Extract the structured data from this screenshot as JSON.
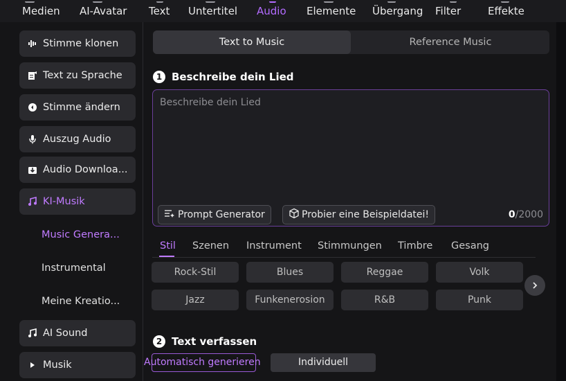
{
  "menu": {
    "tabs": [
      {
        "label": "Medien"
      },
      {
        "label": "AI-Avatar"
      },
      {
        "label": "Text"
      },
      {
        "label": "Untertitel"
      },
      {
        "label": "Audio"
      },
      {
        "label": "Elemente"
      },
      {
        "label": "Übergang"
      },
      {
        "label": "Filter"
      },
      {
        "label": "Effekte"
      }
    ],
    "active": "Audio"
  },
  "sidebar": {
    "items": [
      {
        "label": "Stimme klonen",
        "icon": "waveform-icon"
      },
      {
        "label": "Text zu Sprache",
        "icon": "document-edit-icon"
      },
      {
        "label": "Stimme ändern",
        "icon": "voice-change-icon"
      },
      {
        "label": "Auszug Audio",
        "icon": "microphone-icon"
      },
      {
        "label": "Audio Downloa...",
        "icon": "download-box-icon"
      },
      {
        "label": "KI-Musik",
        "icon": "ai-music-icon"
      }
    ],
    "sub_items": [
      {
        "label": "Music Genera..."
      },
      {
        "label": "Instrumental"
      },
      {
        "label": "Meine Kreatio..."
      }
    ],
    "bottom_items": [
      {
        "label": "AI Sound",
        "icon": "sound-icon"
      },
      {
        "label": "Musik",
        "icon": "caret-right-icon"
      }
    ]
  },
  "mode_tabs": {
    "text_to_music": "Text to Music",
    "reference_music": "Reference Music"
  },
  "section1": {
    "number": "1",
    "title": "Beschreibe dein Lied"
  },
  "description": {
    "placeholder": "Beschreibe dein Lied",
    "value": ""
  },
  "buttons": {
    "prompt_generator": "Prompt Generator",
    "example_file": "Probier eine Beispieldatei!"
  },
  "counter": {
    "current": "0",
    "max": "/2000"
  },
  "categories": [
    {
      "label": "Stil"
    },
    {
      "label": "Szenen"
    },
    {
      "label": "Instrument"
    },
    {
      "label": "Stimmungen"
    },
    {
      "label": "Timbre"
    },
    {
      "label": "Gesang"
    }
  ],
  "styles": [
    {
      "label": "Rock-Stil"
    },
    {
      "label": "Blues"
    },
    {
      "label": "Reggae"
    },
    {
      "label": "Volk"
    },
    {
      "label": "Jazz"
    },
    {
      "label": "Funkenerosion"
    },
    {
      "label": "R&B"
    },
    {
      "label": "Punk"
    }
  ],
  "section2": {
    "number": "2",
    "title": "Text verfassen"
  },
  "lyrics_buttons": {
    "auto": "Automatisch generieren",
    "custom": "Individuell"
  },
  "colors": {
    "accent": "#c07bff",
    "background": "#151517",
    "panel": "#2a2a2e"
  }
}
